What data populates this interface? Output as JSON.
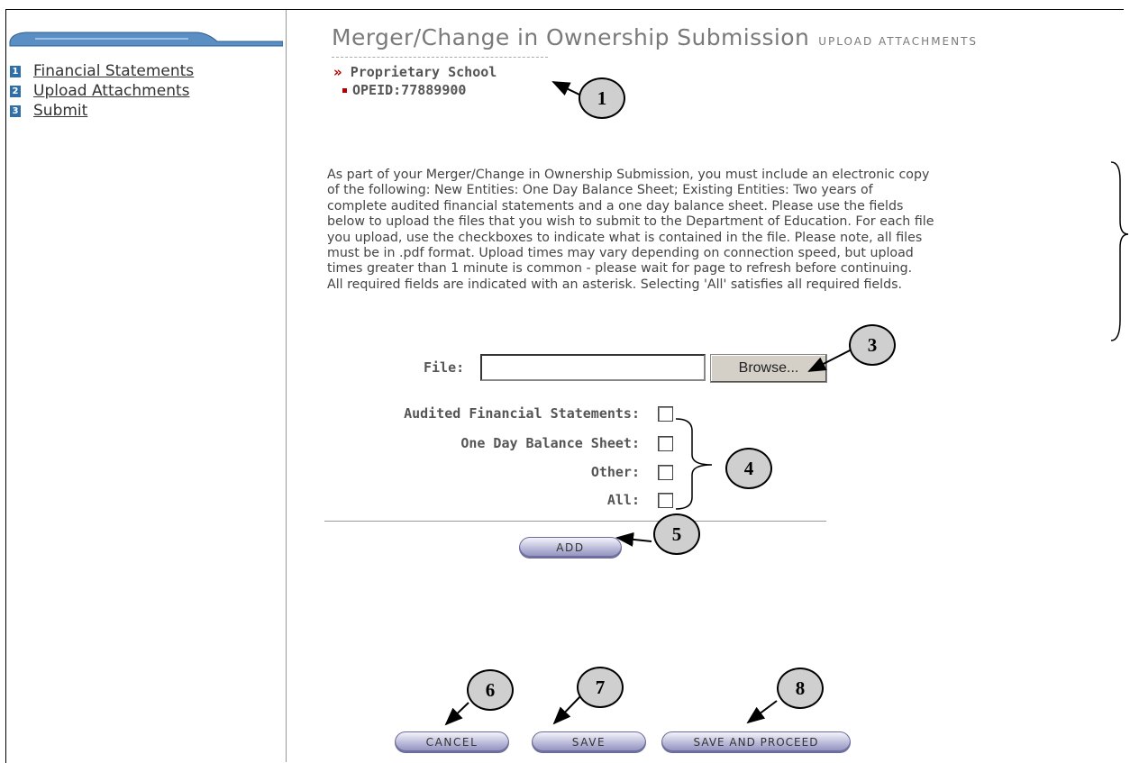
{
  "sidebar": {
    "items": [
      {
        "num": "1",
        "label": "Financial Statements"
      },
      {
        "num": "2",
        "label": "Upload Attachments"
      },
      {
        "num": "3",
        "label": "Submit"
      }
    ]
  },
  "header": {
    "title": "Merger/Change in Ownership Submission",
    "subtitle": "UPLOAD ATTACHMENTS",
    "school_name": "Proprietary School",
    "opeid": "OPEID:77889900"
  },
  "instructions": "As part of your Merger/Change in Ownership Submission, you must include an electronic copy\nof the following: New Entities: One Day Balance Sheet; Existing Entities: Two years of\ncomplete audited financial statements and a one day balance sheet. Please use the fields\nbelow to upload the files that you wish to submit to the Department of Education. For each file\nyou upload, use the checkboxes to indicate what is contained in the file. Please note, all files\nmust be in .pdf format. Upload times may vary depending on connection speed, but upload\ntimes greater than 1 minute is common - please wait for page to refresh before continuing.\nAll required fields are indicated with an asterisk. Selecting 'All' satisfies all required fields.",
  "form": {
    "file_label": "File:",
    "file_value": "",
    "browse_label": "Browse...",
    "checkboxes": [
      {
        "label": "Audited Financial Statements:",
        "checked": false
      },
      {
        "label": "One Day Balance Sheet:",
        "checked": false
      },
      {
        "label": "Other:",
        "checked": false
      },
      {
        "label": "All:",
        "checked": false
      }
    ],
    "add_label": "ADD"
  },
  "buttons": {
    "cancel": "CANCEL",
    "save": "SAVE",
    "save_and_proceed": "SAVE AND PROCEED"
  },
  "callouts": [
    "1",
    "3",
    "4",
    "5",
    "6",
    "7",
    "8"
  ]
}
